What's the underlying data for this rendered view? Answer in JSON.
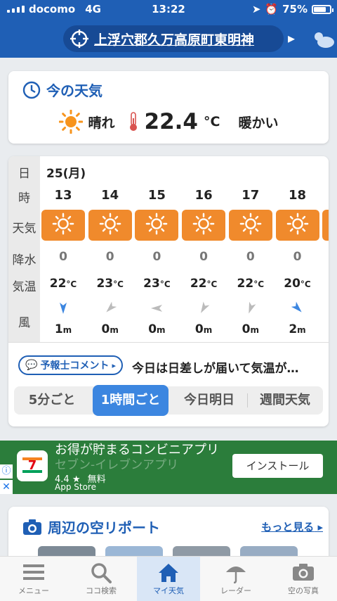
{
  "status": {
    "carrier": "docomo",
    "network": "4G",
    "time": "13:22",
    "battery": "75%"
  },
  "header": {
    "location": "上浮穴郡久万高原町東明神"
  },
  "now": {
    "title": "今の天気",
    "condition": "晴れ",
    "temp": "22.4",
    "unit": "°C",
    "feel": "暖かい"
  },
  "forecast": {
    "labels": {
      "day": "日",
      "hour": "時",
      "weather": "天気",
      "precip": "降水",
      "temp": "気温",
      "wind": "風"
    },
    "date": "25(月)",
    "temp_unit": "°C",
    "wind_unit": "m",
    "hours": [
      {
        "hour": "13",
        "precip": "0",
        "temp": "22",
        "wind": "1",
        "dir_deg": 180,
        "dir_color": "#3c86e0"
      },
      {
        "hour": "14",
        "precip": "0",
        "temp": "23",
        "wind": "0",
        "dir_deg": 225,
        "dir_color": "#bbbbbb"
      },
      {
        "hour": "15",
        "precip": "0",
        "temp": "23",
        "wind": "0",
        "dir_deg": 270,
        "dir_color": "#bbbbbb"
      },
      {
        "hour": "16",
        "precip": "0",
        "temp": "22",
        "wind": "0",
        "dir_deg": 210,
        "dir_color": "#bbbbbb"
      },
      {
        "hour": "17",
        "precip": "0",
        "temp": "22",
        "wind": "0",
        "dir_deg": 200,
        "dir_color": "#bbbbbb"
      },
      {
        "hour": "18",
        "precip": "0",
        "temp": "20",
        "wind": "2",
        "dir_deg": 135,
        "dir_color": "#3c86e0"
      }
    ],
    "comment_badge": "予報士コメント",
    "comment_text": "今日は日差しが届いて気温が…",
    "tabs": [
      "5分ごと",
      "1時間ごと",
      "今日明日",
      "週間天気"
    ],
    "active_tab": 1
  },
  "ad": {
    "title": "お得が貯まるコンビニアプリ",
    "subtitle": "セブン-イレブンアプリ",
    "rating": "4.4",
    "price": "無料",
    "store": "App Store",
    "install": "インストール"
  },
  "sky": {
    "title": "周辺の空リポート",
    "more": "もっと見る"
  },
  "nav": [
    "メニュー",
    "ココ検索",
    "マイ天気",
    "レーダー",
    "空の写真"
  ],
  "colors": {
    "brand": "#1f5fb5",
    "sunny_box": "#f08a2c",
    "ad_bg": "#2b7d3b"
  }
}
